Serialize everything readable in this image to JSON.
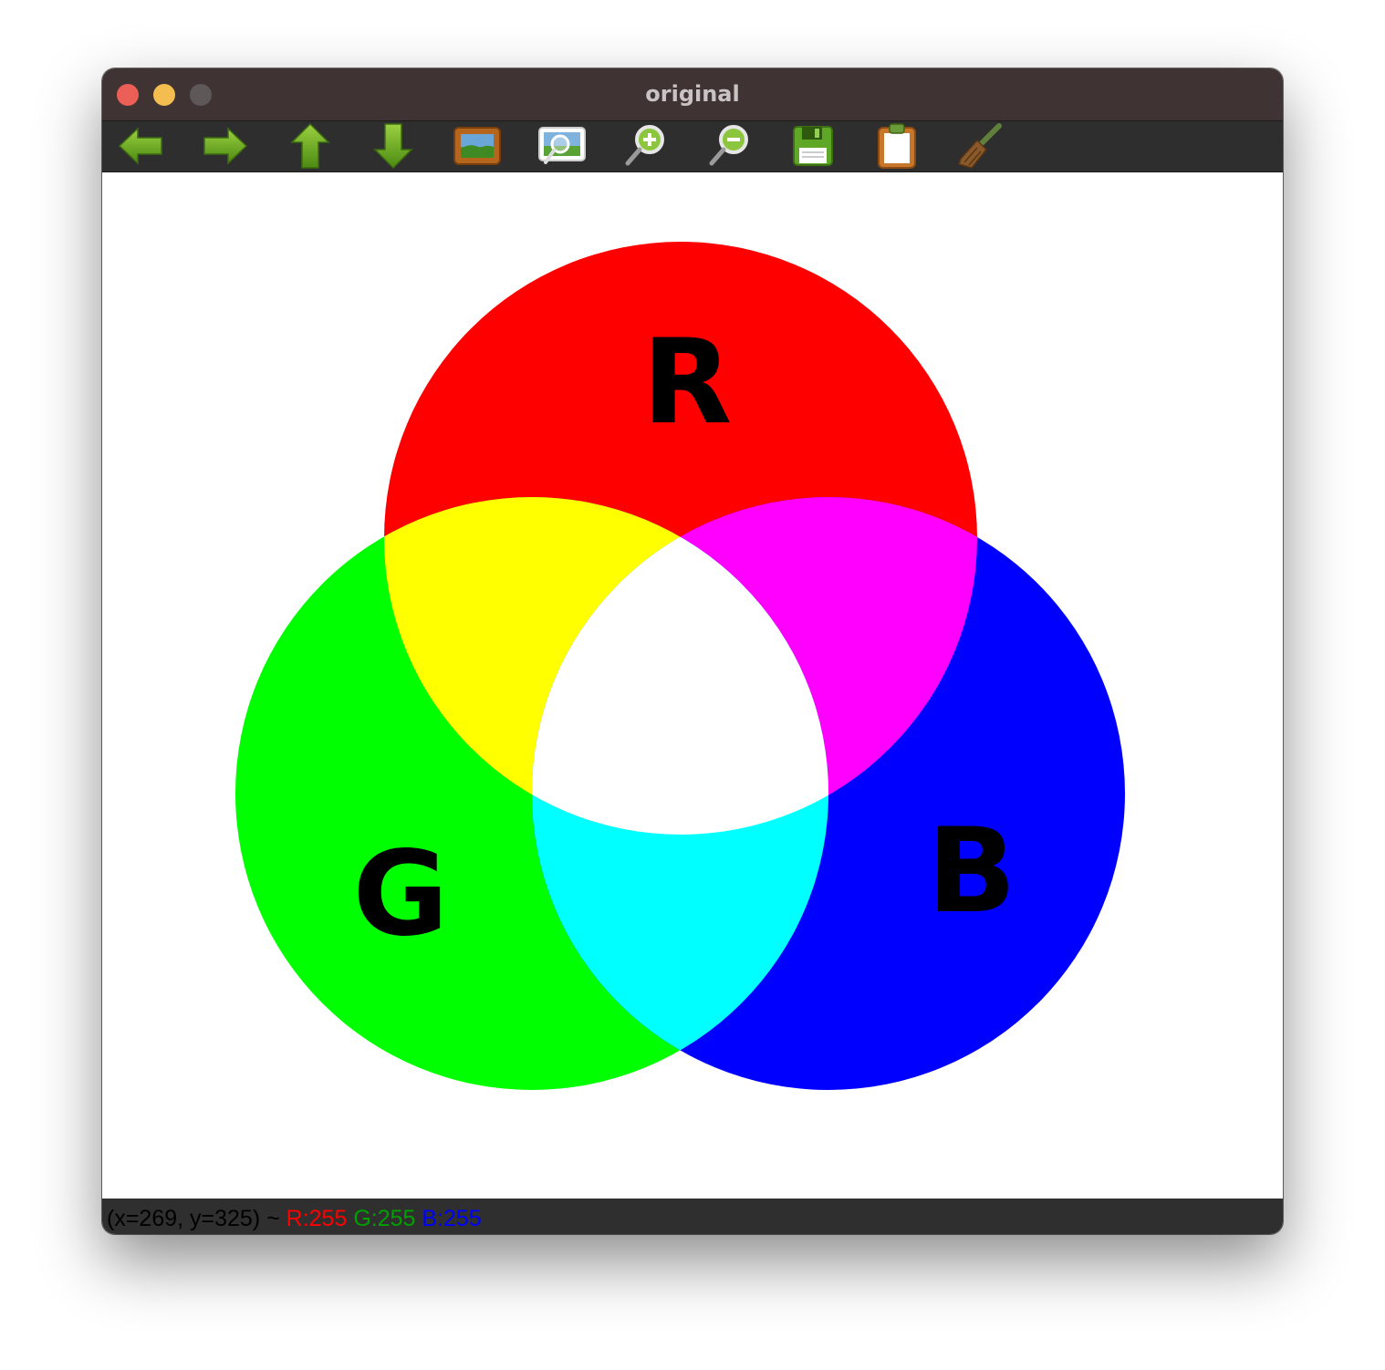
{
  "window": {
    "title": "original",
    "traffic_lights": {
      "close_color": "#ec5f57",
      "minimize_color": "#f4bd4f",
      "maximize_color": "#5f5858"
    }
  },
  "toolbar": {
    "buttons": [
      {
        "icon": "arrow-left-icon"
      },
      {
        "icon": "arrow-right-icon"
      },
      {
        "icon": "arrow-up-icon"
      },
      {
        "icon": "arrow-down-icon"
      },
      {
        "icon": "image-icon"
      },
      {
        "icon": "zoom-image-icon"
      },
      {
        "icon": "zoom-in-icon"
      },
      {
        "icon": "zoom-out-icon"
      },
      {
        "icon": "save-icon"
      },
      {
        "icon": "clipboard-icon"
      },
      {
        "icon": "broom-icon"
      }
    ]
  },
  "image": {
    "circles": [
      {
        "label": "R",
        "color": "#ff0000"
      },
      {
        "label": "G",
        "color": "#00ff00"
      },
      {
        "label": "B",
        "color": "#0000ff"
      }
    ],
    "overlap_colors": {
      "red_green": "#ffff00",
      "red_blue": "#ff00ff",
      "green_blue": "#00ffff",
      "all": "#ffffff"
    }
  },
  "status": {
    "coords": "(x=269, y=325) ~ ",
    "r": "R:255",
    "g": "G:255",
    "b": "B:255",
    "coords_color": "#000000",
    "r_color": "#ff0000",
    "g_color": "#00a000",
    "b_color": "#0000ff"
  }
}
